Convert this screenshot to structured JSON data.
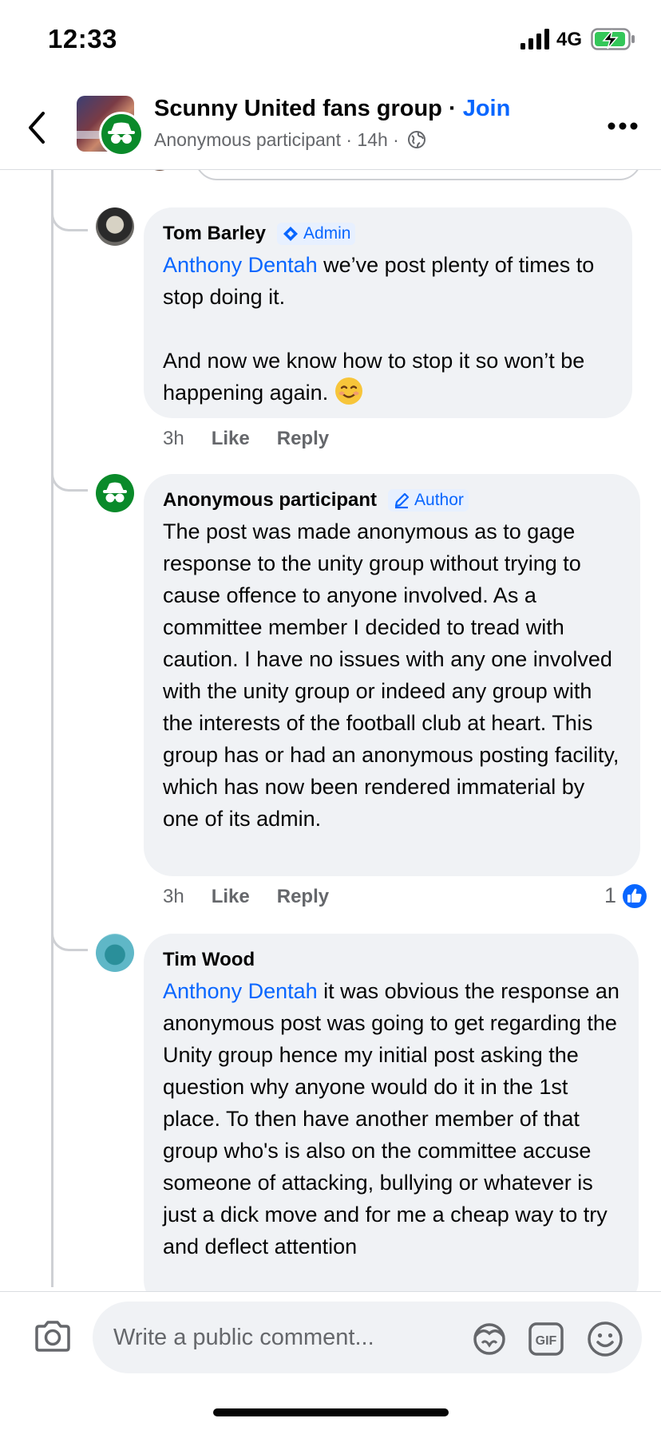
{
  "status_bar": {
    "time": "12:33",
    "network": "4G"
  },
  "header": {
    "group_name": "Scunny United fans group",
    "separator": " · ",
    "join_label": "Join",
    "post_meta": "Anonymous participant · 14h · "
  },
  "comments": [
    {
      "author": "Tom Barley",
      "badge": "Admin",
      "mention": "Anthony Dentah",
      "text_after_mention": " we’ve post plenty of times to stop doing it.",
      "paragraph2": "And now we know how to stop it so won’t be happening again.",
      "emoji": "smiling-face-icon",
      "time": "3h",
      "like_label": "Like",
      "reply_label": "Reply"
    },
    {
      "author": "Anonymous participant",
      "badge": "Author",
      "text": "The post was made anonymous as to gage response to the unity group without trying to cause offence to anyone involved. As a committee member I decided to tread with caution. I have no issues with any one involved with the unity group or indeed any group with the interests of the football club at heart. This group has or had an anonymous posting facility, which has now been rendered immaterial by one of its admin.",
      "time": "3h",
      "like_label": "Like",
      "reply_label": "Reply",
      "reaction_count": "1"
    },
    {
      "author": "Tim Wood",
      "mention": "Anthony Dentah",
      "text_after_mention": " it was obvious the response an anonymous post was going to get regarding the Unity group hence my initial post asking the question why anyone would do it in the 1st place. To then have another member of that group who's is also on the committee  accuse someone of attacking, bullying or whatever is  just a dick move and for me a cheap way to try and deflect attention"
    }
  ],
  "composer": {
    "placeholder": "Write a public comment..."
  },
  "colors": {
    "accent": "#0866ff",
    "bubble": "#f0f2f5",
    "anon_green": "#0a8a2a",
    "meta_gray": "#65676b"
  }
}
